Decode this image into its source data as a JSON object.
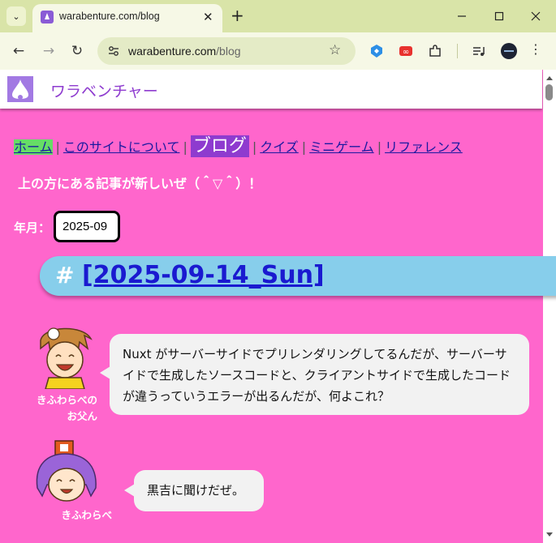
{
  "browser": {
    "tab_title": "warabenture.com/blog",
    "url_host": "warabenture.com",
    "url_path": "/blog"
  },
  "site": {
    "title": "ワラベンチャー",
    "nav": [
      {
        "label": "ホーム",
        "state": "home"
      },
      {
        "label": "このサイトについて",
        "state": "link"
      },
      {
        "label": "ブログ",
        "state": "current"
      },
      {
        "label": "クイズ",
        "state": "link"
      },
      {
        "label": "ミニゲーム",
        "state": "link"
      },
      {
        "label": "リファレンス",
        "state": "link"
      }
    ],
    "intro": "上の方にある記事が新しいぜ（＾▽＾）！",
    "month_label": "年月：",
    "month_value": "2025-09",
    "date_heading_hash": "#",
    "date_heading_link": "[2025-09-14_Sun]"
  },
  "dialogue": [
    {
      "speaker_line1": "きふわらべの",
      "speaker_line2": "お父ん",
      "text": "Nuxt がサーバーサイドでプリレンダリングしてるんだが、サーバーサイドで生成したソースコードと、クライアントサイドで生成したコードが違うっていうエラーが出るんだが、何よこれ？"
    },
    {
      "speaker_line1": "きふわらべ",
      "speaker_line2": "",
      "text": "黒吉に聞けだぜ。"
    }
  ],
  "colors": {
    "page_bg": "#ff66cc",
    "tabstrip_bg": "#d9e4a8",
    "heading_bg": "#87ceeb",
    "accent": "#8e3bcf",
    "home_bg": "#66dd66"
  },
  "icons": [
    "tab-search-icon",
    "close-icon",
    "plus-icon",
    "minimize-icon",
    "maximize-icon",
    "back-icon",
    "forward-icon",
    "reload-icon",
    "site-info-icon",
    "bookmark-star-icon",
    "extension-icon",
    "puzzle-icon",
    "media-icon",
    "profile-icon",
    "menu-icon"
  ]
}
